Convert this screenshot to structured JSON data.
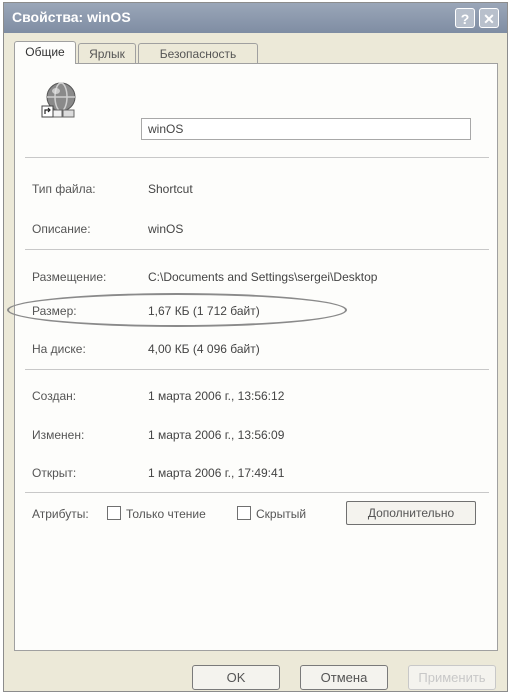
{
  "window": {
    "title": "Свойства: winOS",
    "help_label": "?",
    "close_label": "✕"
  },
  "tabs": [
    {
      "label": "Общие"
    },
    {
      "label": "Ярлык"
    },
    {
      "label": "Безопасность"
    }
  ],
  "file": {
    "name": "winOS",
    "icon": "network-globe-shortcut-icon"
  },
  "properties": {
    "type_label": "Тип файла:",
    "type_value": "Shortcut",
    "description_label": "Описание:",
    "description_value": "winOS",
    "location_label": "Размещение:",
    "location_value": "C:\\Documents and Settings\\sergei\\Desktop",
    "size_label": "Размер:",
    "size_value": "1,67 КБ (1 712 байт)",
    "disk_label": "На диске:",
    "disk_value": "4,00 КБ (4 096 байт)",
    "created_label": "Создан:",
    "created_value": "1 марта 2006 г., 13:56:12",
    "modified_label": "Изменен:",
    "modified_value": "1 марта 2006 г., 13:56:09",
    "accessed_label": "Открыт:",
    "accessed_value": "1 марта 2006 г., 17:49:41"
  },
  "attributes": {
    "label": "Атрибуты:",
    "readonly_label": "Только чтение",
    "readonly_checked": false,
    "hidden_label": "Скрытый",
    "hidden_checked": false,
    "advanced_label": "Дополнительно"
  },
  "buttons": {
    "ok": "OK",
    "cancel": "Отмена",
    "apply": "Применить"
  }
}
